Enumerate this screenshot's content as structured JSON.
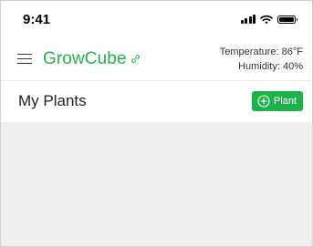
{
  "status_bar": {
    "time": "9:41",
    "icons": [
      "signal-icon",
      "wifi-icon",
      "battery-icon"
    ]
  },
  "header": {
    "menu_icon": "menu-icon",
    "title": "GrowCube",
    "title_icon": "link-icon",
    "temperature": "Temperature: 86°F",
    "humidity": "Humidity: 40%"
  },
  "section": {
    "title": "My Plants",
    "add_button_label": "Plant",
    "add_button_icon": "plus-circle-icon"
  },
  "colors": {
    "accent": "#27b04f",
    "button": "#20b24a",
    "content_bg": "#f0f0f0"
  }
}
